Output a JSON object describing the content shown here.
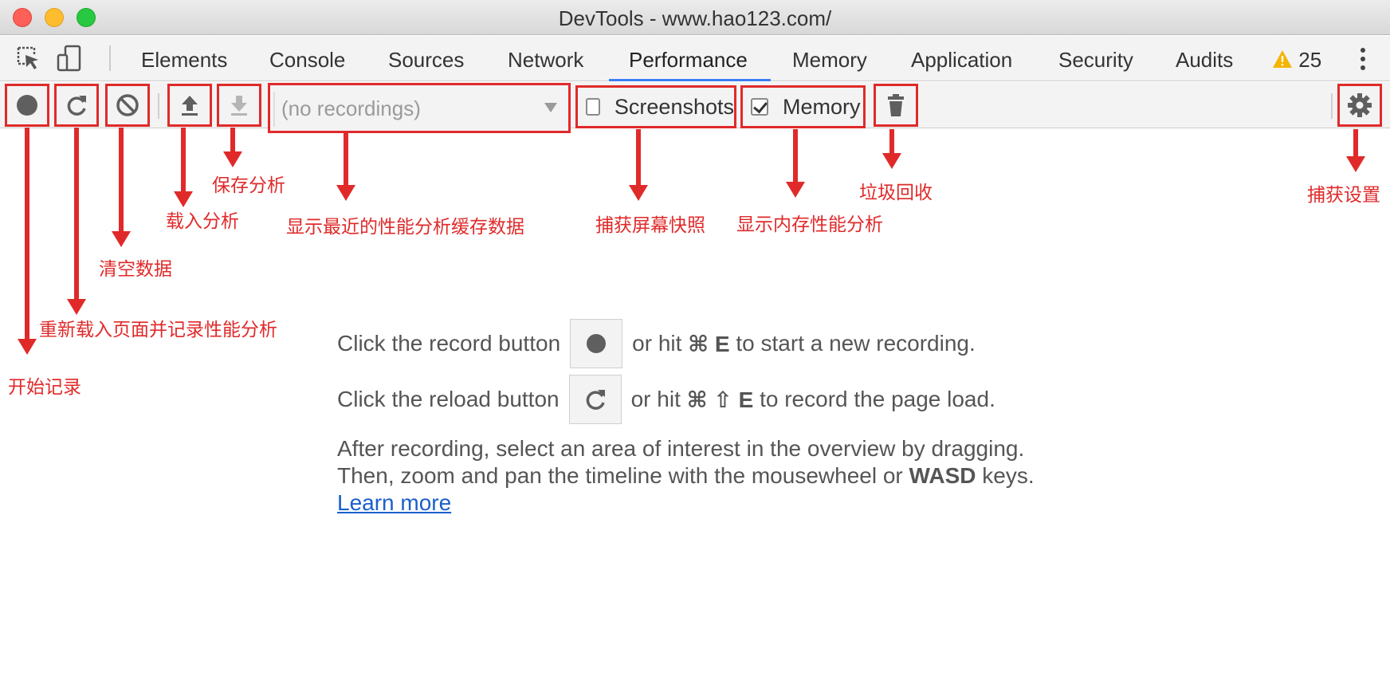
{
  "window": {
    "title": "DevTools - www.hao123.com/"
  },
  "tabs": [
    {
      "label": "Elements"
    },
    {
      "label": "Console"
    },
    {
      "label": "Sources"
    },
    {
      "label": "Network"
    },
    {
      "label": "Performance",
      "active": true
    },
    {
      "label": "Memory"
    },
    {
      "label": "Application"
    },
    {
      "label": "Security"
    },
    {
      "label": "Audits"
    }
  ],
  "warnings": {
    "count": "25",
    "icon": "warning-icon"
  },
  "toolbar": {
    "recordings_placeholder": "(no recordings)",
    "screenshots_label": "Screenshots",
    "screenshots_checked": false,
    "memory_label": "Memory",
    "memory_checked": true
  },
  "annotations": {
    "record": "开始记录",
    "reload": "重新载入页面并记录性能分析",
    "clear": "清空数据",
    "load": "载入分析",
    "save": "保存分析",
    "recordings": "显示最近的性能分析缓存数据",
    "screenshots": "捕获屏幕快照",
    "memory": "显示内存性能分析",
    "gc": "垃圾回收",
    "settings": "捕获设置"
  },
  "landing": {
    "line1_pre": "Click the record button",
    "line1_mid": "or hit",
    "line1_key": "⌘ E",
    "line1_post": "to start a new recording.",
    "line2_pre": "Click the reload button",
    "line2_mid": "or hit",
    "line2_key": "⌘ ⇧ E",
    "line2_post": "to record the page load.",
    "para_line1": "After recording, select an area of interest in the overview by dragging.",
    "para_line2_pre": "Then, zoom and pan the timeline with the mousewheel or",
    "para_line2_bold": "WASD",
    "para_line2_post": "keys.",
    "learn_more": "Learn more"
  },
  "colors": {
    "annotation_red": "#e02a2a",
    "tab_underline": "#3b7ff5",
    "link": "#1a5fcc",
    "warning": "#f4b400"
  }
}
